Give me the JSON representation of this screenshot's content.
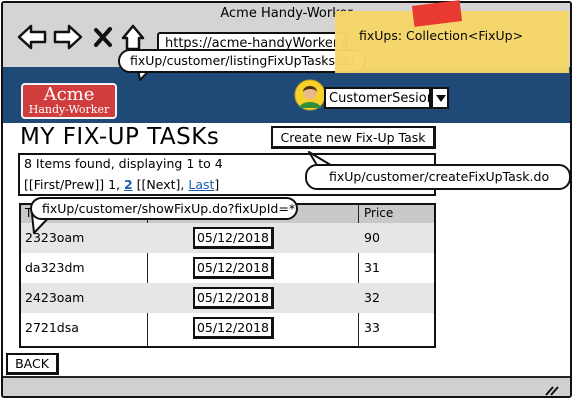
{
  "window": {
    "title": "Acme Handy-Worker"
  },
  "browser": {
    "url": "https://acme-handyWorker.com"
  },
  "header": {
    "logo": {
      "line1": "Acme",
      "line2": "Handy-Worker"
    },
    "user": {
      "name": "CustomerSesion"
    }
  },
  "page": {
    "title": "MY FIX-UP TASKs",
    "create_button": "Create new Fix-Up Task",
    "results": {
      "summary": "8 Items found, displaying 1 to 4",
      "pager_prefix": "[[First/Prew]] 1, ",
      "page2": "2",
      "pager_mid": " [[Next], ",
      "last": "Last",
      "pager_suffix": "]"
    },
    "table": {
      "headers": {
        "ticker": "T",
        "price": "Price"
      },
      "rows": [
        {
          "ticker": "2323oam",
          "date": "05/12/2018",
          "price": "90"
        },
        {
          "ticker": "da323dm",
          "date": "05/12/2018",
          "price": "31"
        },
        {
          "ticker": "2423oam",
          "date": "05/12/2018",
          "price": "32"
        },
        {
          "ticker": "2721dsa",
          "date": "05/12/2018",
          "price": "33"
        }
      ]
    },
    "back_button": "BACK"
  },
  "annotations": {
    "listing_url": "fixUp/customer/listingFixUpTasks.do",
    "create_url": "fixUp/customer/createFixUpTask.do",
    "show_url": "fixUp/customer/showFixUp.do?fixUpId=*",
    "sticky_note": "fixUps:  Collection<FixUp>"
  },
  "colors": {
    "banner": "#1f4a77",
    "logo": "#d03d3d",
    "sticky": "#f7d76a",
    "tape": "#e83a30",
    "link": "#1a5fa8"
  }
}
